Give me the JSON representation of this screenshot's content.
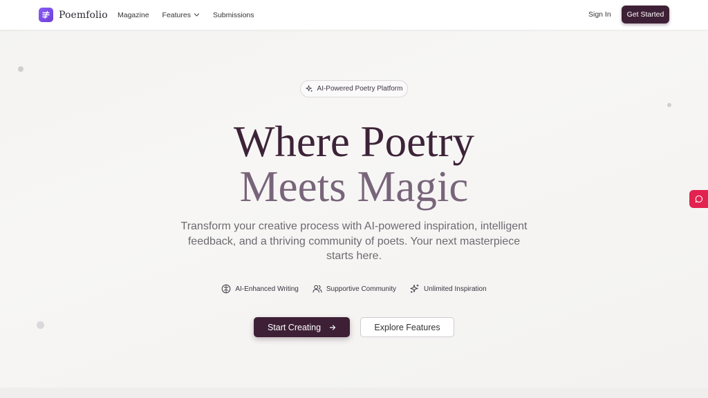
{
  "brand": {
    "name": "Poemfolio",
    "logo_icon": "menu-lines-icon",
    "accent": "#7c4ee8"
  },
  "nav": {
    "items": [
      {
        "label": "Magazine"
      },
      {
        "label": "Features",
        "has_dropdown": true
      },
      {
        "label": "Submissions"
      }
    ],
    "sign_in": "Sign In",
    "get_started": "Get Started"
  },
  "hero": {
    "badge": "AI-Powered Poetry Platform",
    "title_line1": "Where Poetry",
    "title_line2": "Meets Magic",
    "subtitle": "Transform your creative process with AI-powered inspiration, intelligent feedback, and a thriving community of poets. Your next masterpiece starts here.",
    "features": [
      {
        "icon": "brain-icon",
        "label": "AI-Enhanced Writing"
      },
      {
        "icon": "users-icon",
        "label": "Supportive Community"
      },
      {
        "icon": "sparkles-icon",
        "label": "Unlimited Inspiration"
      }
    ],
    "primary_cta": "Start Creating",
    "secondary_cta": "Explore Features"
  },
  "colors": {
    "primary": "#3e2036",
    "title_dark": "#3d2338",
    "title_light": "#78657a",
    "chat_widget": "#e2234f"
  }
}
